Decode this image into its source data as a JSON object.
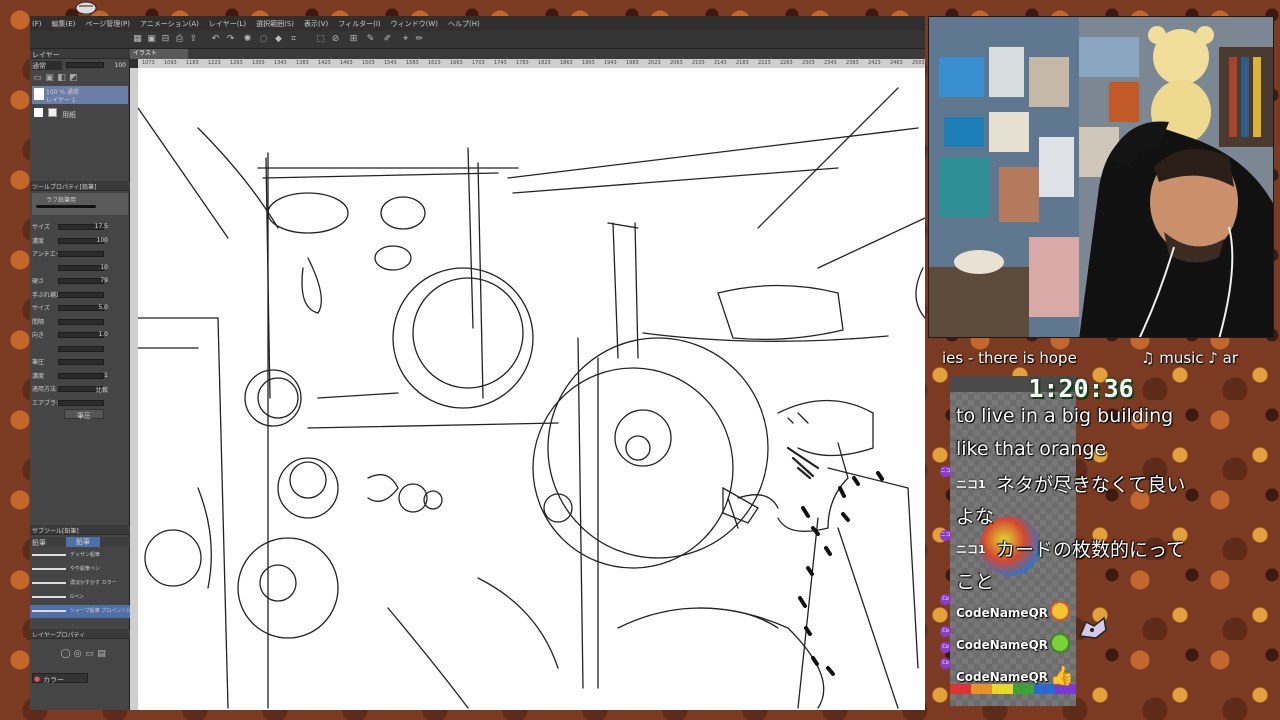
{
  "app": {
    "menu": [
      "(F)",
      "編集(E)",
      "ページ管理(P)",
      "アニメーション(A)",
      "レイヤー(L)",
      "選択範囲(S)",
      "表示(V)",
      "フィルター(I)",
      "ウィンドウ(W)",
      "ヘルプ(H)"
    ],
    "doc_tab": "イラスト",
    "layer_panel": {
      "header": "レイヤー",
      "blend": "通常",
      "opacity": "100",
      "layers": [
        {
          "name": "100 % 通常",
          "sub": "レイヤー 1"
        },
        {
          "name": "用紙"
        }
      ]
    },
    "tool_property": {
      "header": "ツールプロパティ[鉛筆]",
      "tool": "ラフ鉛筆用",
      "rows": [
        {
          "label": "サイズ",
          "value": "17.5"
        },
        {
          "label": "濃度",
          "value": "100"
        },
        {
          "label": "アンチエイリアス",
          "value": ""
        },
        {
          "label": "",
          "value": "10"
        },
        {
          "label": "硬さ",
          "value": "79"
        },
        {
          "label": "手ぶれ補正",
          "value": ""
        },
        {
          "label": "サイズ",
          "value": "5.0"
        },
        {
          "label": "間隔",
          "value": ""
        },
        {
          "label": "向き",
          "value": "1.0"
        },
        {
          "label": "",
          "value": ""
        },
        {
          "label": "筆圧",
          "value": ""
        },
        {
          "label": "濃度",
          "value": "1"
        },
        {
          "label": "適用方法",
          "value": "比較"
        },
        {
          "label": "エアブラシ",
          "value": ""
        }
      ],
      "pressure_button": "筆圧"
    },
    "sub_tool": {
      "header": "サブツール[鉛筆]",
      "tabs": [
        "鉛筆",
        "鉛筆"
      ],
      "items": [
        "デッサン鉛筆",
        "やや鉛筆ペン",
        "濃淡かすかす カラー",
        "Gペン",
        "シャープ鉛筆 プロペンシル用"
      ]
    },
    "layer_property": "レイヤープロパティ",
    "color_label": "カラー",
    "ruler_ticks": [
      "1073",
      "1093",
      "1183",
      "1223",
      "1263",
      "1303",
      "1343",
      "1383",
      "1423",
      "1463",
      "1503",
      "1543",
      "1583",
      "1623",
      "1663",
      "1703",
      "1743",
      "1783",
      "1823",
      "1863",
      "1903",
      "1943",
      "1983",
      "2023",
      "2063",
      "2103",
      "2143",
      "2183",
      "2223",
      "2263",
      "2303",
      "2343",
      "2383",
      "2423",
      "2463",
      "2503"
    ]
  },
  "overlay": {
    "marquee_left": "ies - there is hope",
    "marquee_right": "♫ music ♪ ar",
    "timer": "1:20:36",
    "chat": [
      {
        "text": "to live in a big building"
      },
      {
        "text": "like that orange"
      },
      {
        "prefix": "ニコ1",
        "text": "ネタが尽きなくて良い"
      },
      {
        "text": "よな"
      },
      {
        "prefix": "ニコ1",
        "text": "カードの枚数的にって"
      },
      {
        "text": "こと"
      }
    ],
    "users": [
      {
        "name": "CodeNameQR",
        "emoji": "grinning-emoji"
      },
      {
        "name": "CodeNameQR",
        "emoji": "green-face-emoji"
      },
      {
        "name": "CodeNameQR",
        "emoji": "thumbs-up-emoji"
      }
    ],
    "badge_co": "Co",
    "badge_ni": "ニコ"
  }
}
